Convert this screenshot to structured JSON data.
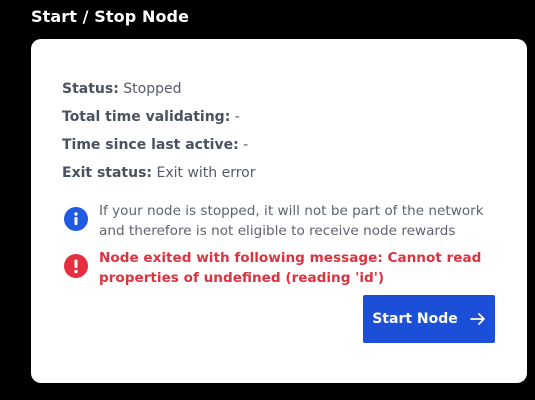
{
  "section": {
    "title": "Start / Stop Node"
  },
  "status": {
    "status_label": "Status:",
    "status_value": "Stopped",
    "total_time_label": "Total time validating:",
    "total_time_value": "-",
    "since_active_label": "Time since last active:",
    "since_active_value": "-",
    "exit_status_label": "Exit status:",
    "exit_status_value": "Exit with error"
  },
  "notices": {
    "info": {
      "icon": "info-icon",
      "text": "If your node is stopped, it will not be part of the network and therefore is not eligible to receive node rewards"
    },
    "error": {
      "icon": "error-icon",
      "text": "Node exited with following message: Cannot read properties of undefined (reading 'id')"
    }
  },
  "actions": {
    "start_label": "Start Node",
    "start_icon": "arrow-right-icon"
  },
  "colors": {
    "background": "#000000",
    "card": "#ffffff",
    "accent": "#1b4fd8",
    "info": "#1f5ae0",
    "error": "#e62e3e"
  }
}
